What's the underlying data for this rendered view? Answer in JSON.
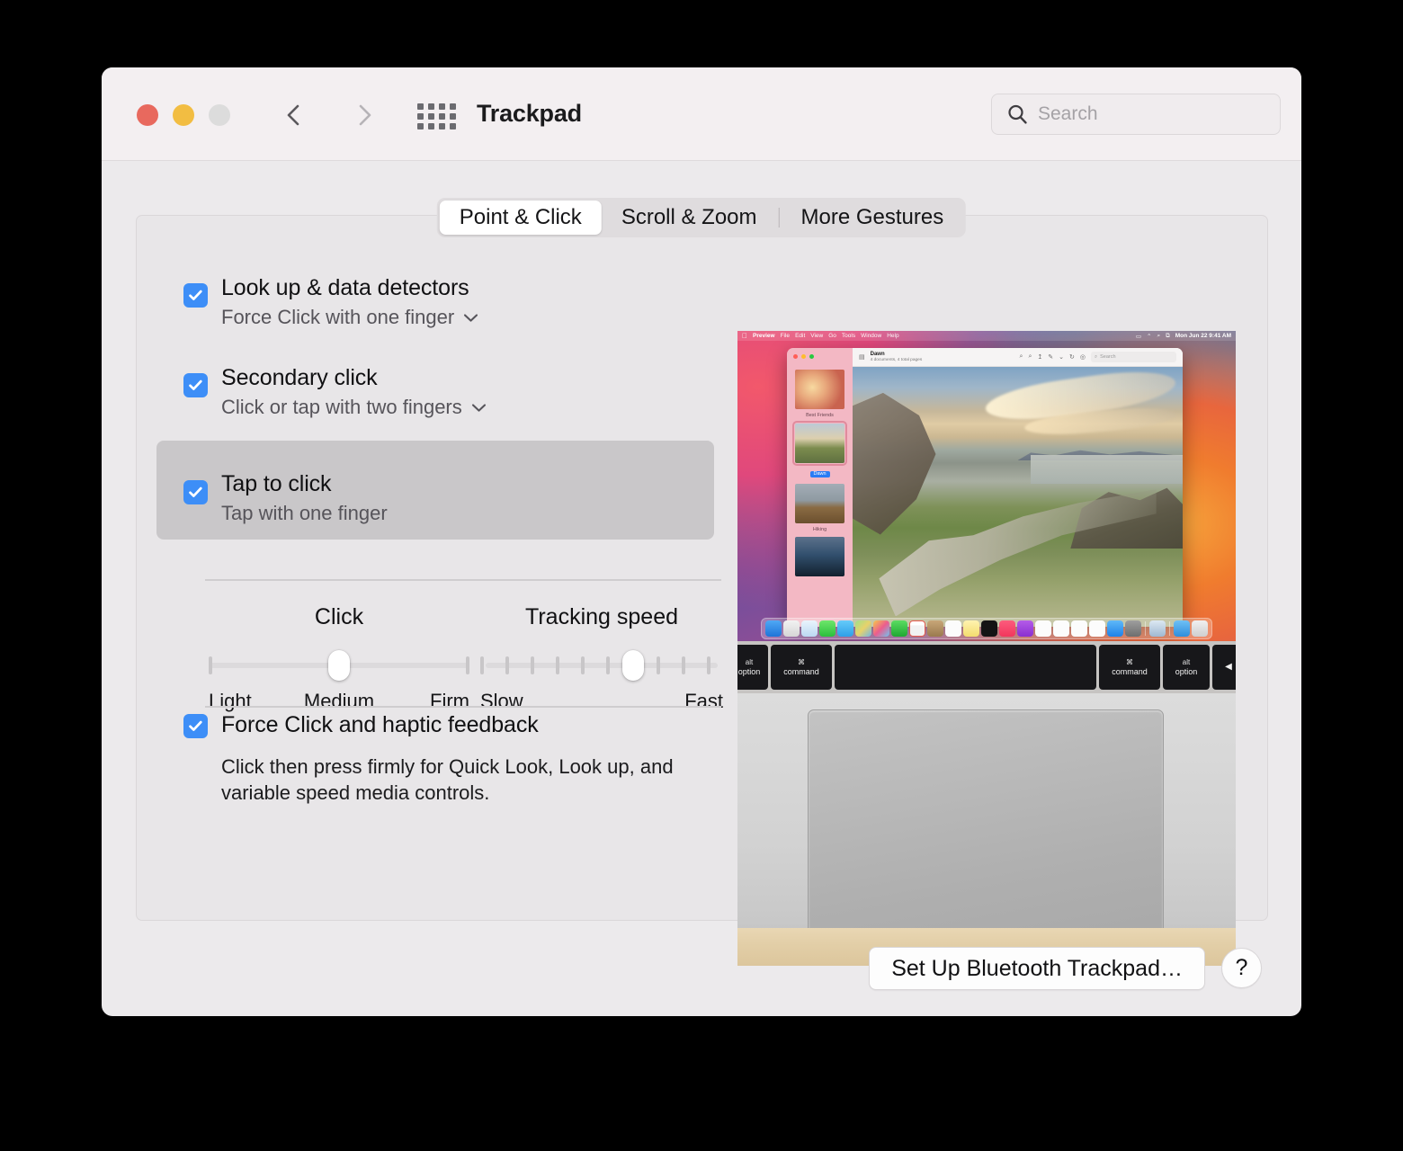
{
  "window": {
    "title": "Trackpad",
    "traffic_lights": [
      "close",
      "minimize",
      "zoom"
    ],
    "nav": {
      "back_icon": "chevron-left-icon",
      "forward_icon": "chevron-right-icon",
      "grid_icon": "show-all-grid-icon"
    },
    "search": {
      "placeholder": "Search",
      "value": "",
      "icon": "search-icon"
    }
  },
  "tabs": [
    {
      "label": "Point & Click",
      "selected": true
    },
    {
      "label": "Scroll & Zoom",
      "selected": false
    },
    {
      "label": "More Gestures",
      "selected": false
    }
  ],
  "options": [
    {
      "title": "Look up & data detectors",
      "subtitle": "Force Click with one finger",
      "checked": true,
      "has_popup": true,
      "highlighted": false
    },
    {
      "title": "Secondary click",
      "subtitle": "Click or tap with two fingers",
      "checked": true,
      "has_popup": true,
      "highlighted": false
    },
    {
      "title": "Tap to click",
      "subtitle": "Tap with one finger",
      "checked": true,
      "has_popup": false,
      "highlighted": true
    }
  ],
  "sliders": {
    "click": {
      "label": "Click",
      "ticks": 3,
      "value_index": 1,
      "scale": [
        "Light",
        "Medium",
        "Firm"
      ]
    },
    "tracking_speed": {
      "label": "Tracking speed",
      "ticks": 10,
      "value_index": 6,
      "scale": [
        "Slow",
        "Fast"
      ]
    }
  },
  "force_click": {
    "title": "Force Click and haptic feedback",
    "checked": true,
    "description": "Click then press firmly for Quick Look, Look up, and variable speed media controls."
  },
  "footer": {
    "setup_button": "Set Up Bluetooth Trackpad…",
    "help_button": "?"
  },
  "preview": {
    "menubar": {
      "apple": "",
      "items": [
        "Preview",
        "File",
        "Edit",
        "View",
        "Go",
        "Tools",
        "Window",
        "Help"
      ],
      "status_icons": [
        "battery-icon",
        "wifi-icon",
        "search-icon",
        "control-center-icon"
      ],
      "clock": "Mon Jun 22  9:41 AM"
    },
    "app_window": {
      "doc_title": "Dawn",
      "doc_subtitle": "4 documents, 4 total pages",
      "toolbar_icons": [
        "sidebar-icon",
        "zoom-out-icon",
        "zoom-in-icon",
        "share-icon",
        "markup-icon",
        "chevron-down-icon",
        "rotate-icon",
        "annotate-icon"
      ],
      "search_placeholder": "Search",
      "sidebar_items": [
        {
          "caption": "Best Friends",
          "selected": false
        },
        {
          "caption": "Dawn",
          "selected": true
        },
        {
          "caption": "Hiking",
          "selected": false
        },
        {
          "caption": "",
          "selected": false
        }
      ]
    },
    "keyboard_keys": [
      {
        "top": "alt",
        "bottom": "option"
      },
      {
        "top": "⌘",
        "bottom": "command"
      },
      {
        "top": "",
        "bottom": ""
      },
      {
        "top": "⌘",
        "bottom": "command"
      },
      {
        "top": "alt",
        "bottom": "option"
      },
      {
        "top": "",
        "bottom": "◀"
      }
    ],
    "dock_icon_count": 22
  },
  "colors": {
    "accent": "#3D8EF7",
    "window_bg": "#ECEAEC",
    "titlebar_bg": "#F3EFF1",
    "panel_bg": "#E8E6E8",
    "highlight_row": "#C9C7C9",
    "close": "#E8695E",
    "minimize": "#F2BD42",
    "zoom": "#DCDCDC"
  }
}
